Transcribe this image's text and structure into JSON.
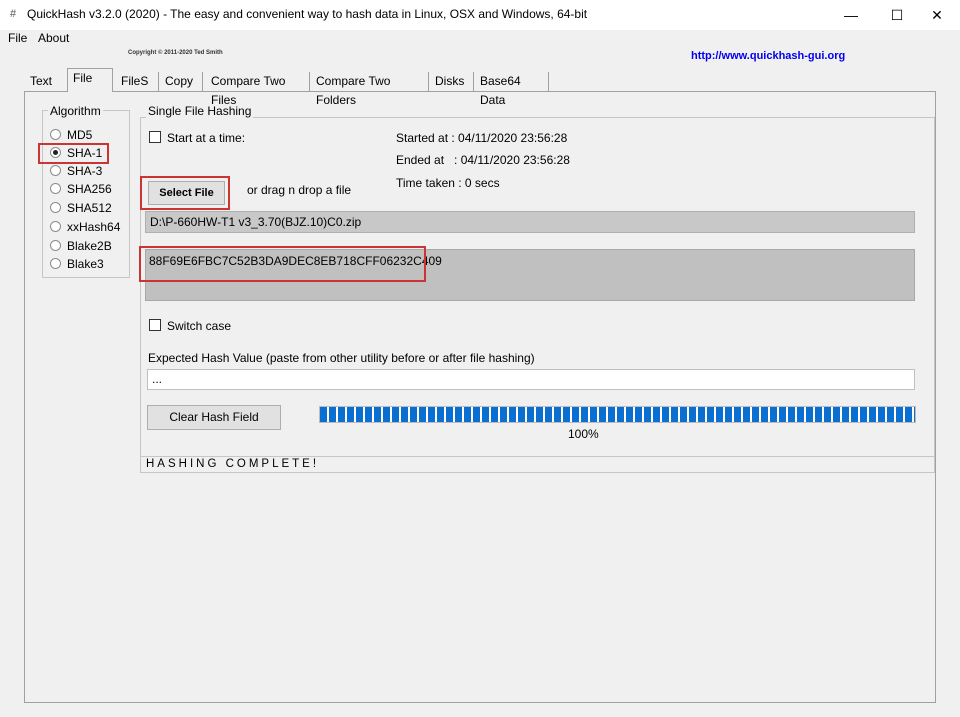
{
  "window": {
    "title": "QuickHash v3.2.0 (2020) - The easy and convenient way to hash data in Linux, OSX and Windows, 64-bit",
    "minimize": "—",
    "maximize": "☐",
    "close": "✕"
  },
  "menu": {
    "file": "File",
    "about": "About"
  },
  "header": {
    "copyright": "Copyright © 2011-2020  Ted Smith",
    "url": "http://www.quickhash-gui.org"
  },
  "tabs": [
    {
      "label": "Text"
    },
    {
      "label": "File"
    },
    {
      "label": "FileS"
    },
    {
      "label": "Copy"
    },
    {
      "label": "Compare Two Files"
    },
    {
      "label": "Compare Two Folders"
    },
    {
      "label": "Disks"
    },
    {
      "label": "Base64 Data"
    }
  ],
  "algorithm": {
    "legend": "Algorithm",
    "selected": "SHA-1",
    "options": [
      "MD5",
      "SHA-1",
      "SHA-3",
      "SHA256",
      "SHA512",
      "xxHash64",
      "Blake2B",
      "Blake3"
    ]
  },
  "single_file": {
    "legend": "Single File Hashing",
    "start_at_label": "Start at a time:",
    "started": "Started at : 04/11/2020 23:56:28",
    "ended": "Ended at   : 04/11/2020 23:56:28",
    "taken": "Time taken : 0 secs",
    "select_button": "Select File",
    "drag_text": "or drag n drop a file",
    "file_path": "D:\\P-660HW-T1 v3_3.70(BJZ.10)C0.zip",
    "hash_value": "88F69E6FBC7C52B3DA9DEC8EB718CFF06232C409",
    "switch_case": "Switch case",
    "expected_label": "Expected Hash Value (paste from other utility before or after file hashing)",
    "expected_value": "...",
    "clear_button": "Clear Hash Field",
    "progress": 100,
    "progress_label": "100%",
    "status": "HASHING COMPLETE!"
  },
  "colors": {
    "progress": "#0a6fd1",
    "highlight": "#cc3333",
    "url": "#0000ee"
  },
  "icons": {
    "app": "quickhash-app-icon"
  }
}
